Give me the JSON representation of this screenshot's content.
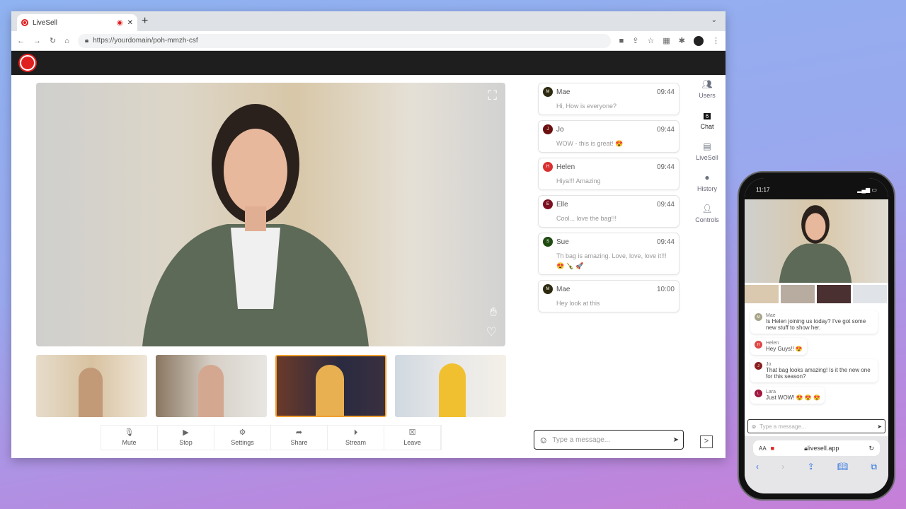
{
  "browser": {
    "tab_title": "LiveSell",
    "url": "https://yourdomain/poh-mmzh-csf"
  },
  "controls": [
    {
      "icon": "mic-icon",
      "label": "Mute"
    },
    {
      "icon": "video-icon",
      "label": "Stop"
    },
    {
      "icon": "gear-icon",
      "label": "Settings"
    },
    {
      "icon": "share-icon",
      "label": "Share"
    },
    {
      "icon": "play-icon",
      "label": "Stream"
    },
    {
      "icon": "close-icon",
      "label": "Leave"
    }
  ],
  "chat": {
    "messages": [
      {
        "initial": "M",
        "name": "Mae",
        "time": "09:44",
        "text": "Hi, How is everyone?",
        "color": "#2e2a10"
      },
      {
        "initial": "J",
        "name": "Jo",
        "time": "09:44",
        "text": "WOW - this is great! 😍",
        "color": "#6b0f0f"
      },
      {
        "initial": "H",
        "name": "Helen",
        "time": "09:44",
        "text": "Hiya!!! Amazing",
        "color": "#d93030"
      },
      {
        "initial": "E",
        "name": "Elle",
        "time": "09:44",
        "text": "Cool... love the bag!!!",
        "color": "#7a1020"
      },
      {
        "initial": "S",
        "name": "Sue",
        "time": "09:44",
        "text": "Th bag is amazing. Love, love, love it!!! 😍 🍾 🚀",
        "color": "#1f4a10"
      },
      {
        "initial": "M",
        "name": "Mae",
        "time": "10:00",
        "text": "Hey look at this",
        "color": "#2e2a10"
      }
    ],
    "placeholder": "Type a message..."
  },
  "sidebar": [
    {
      "icon": "users-icon",
      "label": "Users"
    },
    {
      "icon": "chat-icon",
      "label": "Chat",
      "badge": "6"
    },
    {
      "icon": "store-icon",
      "label": "LiveSell"
    },
    {
      "icon": "clock-icon",
      "label": "History"
    },
    {
      "icon": "user-gear-icon",
      "label": "Controls"
    }
  ],
  "phone": {
    "time": "11:17",
    "url": "livesell.app",
    "placeholder": "Type a message...",
    "text_size": "AA",
    "messages": [
      {
        "initial": "M",
        "name": "Mae",
        "text": "Is Helen joining us today? I've got some new stuff to show her.",
        "color": "#a8a48a"
      },
      {
        "initial": "H",
        "name": "Helen",
        "text": "Hey Guys!! 😍",
        "color": "#e04848"
      },
      {
        "initial": "J",
        "name": "Jo",
        "text": "That bag looks amazing! Is it the new one for this season?",
        "color": "#8a2020"
      },
      {
        "initial": "L",
        "name": "Lara",
        "text": "Just WOW! 😍 😍 😍",
        "color": "#a01840"
      }
    ]
  }
}
